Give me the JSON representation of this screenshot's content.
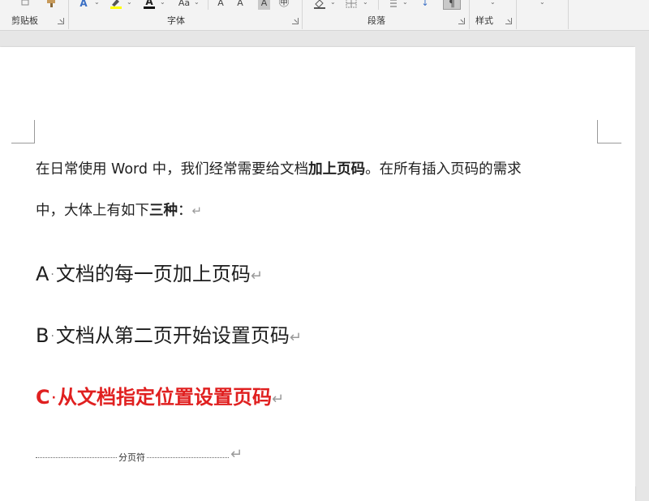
{
  "ribbon": {
    "groups": {
      "clipboard": "剪贴板",
      "font": "字体",
      "paragraph": "段落",
      "styles": "样式"
    },
    "glyphs": {
      "text_effects": "A",
      "highlight": "✎",
      "font_color": "A",
      "change_case": "Aa",
      "grow_font": "A",
      "shrink_font": "A",
      "char_shading": "A",
      "enclose_char": "㊥",
      "sort": "↓",
      "show_marks": "¶"
    }
  },
  "document": {
    "intro_line1": {
      "prefix": "在日常使用 Word 中，我们经常需要给文档",
      "bold": "加上页码",
      "suffix": "。在所有插入页码的需求"
    },
    "intro_line2": {
      "prefix": "中，大体上有如下",
      "bold": "三种",
      "suffix": "："
    },
    "items": [
      {
        "letter": "A",
        "text": "文档的每一页加上页码"
      },
      {
        "letter": "B",
        "text": "文档从第二页开始设置页码"
      },
      {
        "letter": "C",
        "text": "从文档指定位置设置页码"
      }
    ],
    "page_break_label": "分页符",
    "para_mark": "↵",
    "list_dot": "·"
  },
  "colors": {
    "accent_red": "#e02020",
    "text": "#222222",
    "ribbon_bg": "#f3f3f3",
    "canvas_bg": "#e6e6e6"
  }
}
